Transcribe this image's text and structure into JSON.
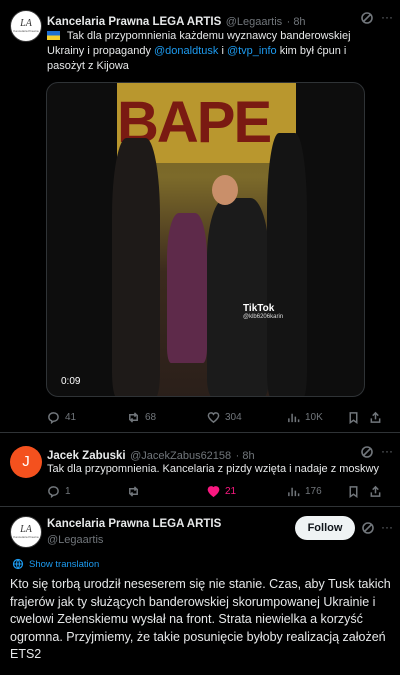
{
  "post1": {
    "author": "Kancelaria Prawna LEGA ARTIS",
    "handle": "@Legaartis",
    "time": "· 8h",
    "text_before": " Tak dla przypomnienia każdemu wyznawcy banderowskiej Ukrainy i propagandy ",
    "mention1": "@donaldtusk",
    "mid": " i ",
    "mention2": "@tvp_info",
    "text_after": "  kim był ćpun i pasożyt z Kijowa",
    "video": {
      "sign_text": "BAPE",
      "watermark": "TikTok",
      "watermark_handle": "@klb6206karin",
      "duration": "0:09"
    },
    "stats": {
      "replies": "41",
      "reposts": "68",
      "likes": "304",
      "views": "10K"
    }
  },
  "reply": {
    "avatar_letter": "J",
    "author": "Jacek Zabuski",
    "handle": "@JacekZabus62158",
    "time": "· 8h",
    "text": "Tak dla przypomnienia. Kancelaria z pizdy wzięta i nadaje z moskwy",
    "stats": {
      "replies": "1",
      "reposts": "",
      "likes": "21",
      "views": "176"
    },
    "like_color": "#f91880"
  },
  "main": {
    "author": "Kancelaria Prawna LEGA ARTIS",
    "handle": "@Legaartis",
    "follow_label": "Follow",
    "show_translation": "Show translation",
    "text": "Kto się torbą urodził neseserem się nie stanie. Czas, aby Tusk takich frajerów jak ty służących banderowskiej skorumpowanej Ukrainie i cwelowi Zełenskiemu wysłał na front. Strata niewielka a korzyść ogromna. Przyjmiemy, że takie posunięcie byłoby realizacją założeń ETS2"
  },
  "logo": {
    "mark": "LA",
    "tiny": "Kancelaria Prawna"
  }
}
